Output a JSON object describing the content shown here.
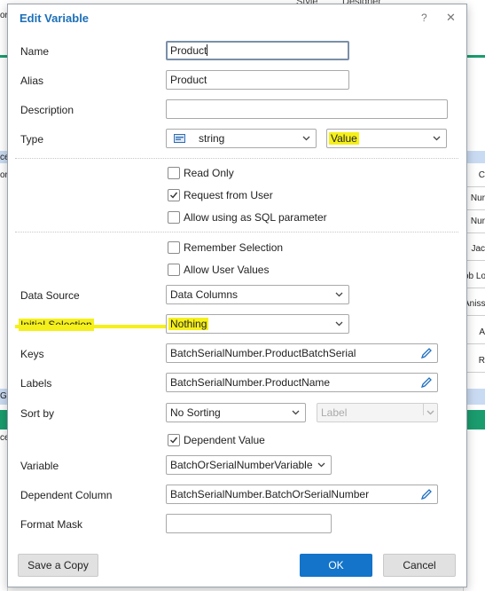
{
  "background": {
    "top_text_1": "Style",
    "top_text_2": "Designer",
    "right_cells": [
      "C",
      "Nur",
      "Nur",
      "Jac",
      "ob Lo",
      "Aniss",
      "A",
      "R"
    ],
    "left_cells": [
      "or",
      "ce",
      "or",
      "Go",
      "ce"
    ]
  },
  "dialog": {
    "title": "Edit Variable",
    "help_label": "?",
    "close_label": "✕"
  },
  "fields": {
    "name": {
      "label": "Name",
      "value": "Product"
    },
    "alias": {
      "label": "Alias",
      "value": "Product"
    },
    "description": {
      "label": "Description",
      "value": ""
    },
    "type": {
      "label": "Type",
      "value": "string",
      "kind_value": "Value"
    },
    "data_source": {
      "label": "Data Source",
      "value": "Data Columns"
    },
    "initial_selection": {
      "label": "Initial Selection",
      "value": "Nothing"
    },
    "keys": {
      "label": "Keys",
      "value": "BatchSerialNumber.ProductBatchSerial"
    },
    "labels": {
      "label": "Labels",
      "value": "BatchSerialNumber.ProductName"
    },
    "sort_by": {
      "label": "Sort by",
      "value": "No Sorting",
      "secondary_value": "Label"
    },
    "variable": {
      "label": "Variable",
      "value": "BatchOrSerialNumberVariable"
    },
    "dependent_column": {
      "label": "Dependent Column",
      "value": "BatchSerialNumber.BatchOrSerialNumber"
    },
    "format_mask": {
      "label": "Format Mask",
      "value": ""
    }
  },
  "checkboxes": {
    "read_only": {
      "label": "Read Only",
      "checked": false
    },
    "request_from_user": {
      "label": "Request from User",
      "checked": true
    },
    "allow_sql": {
      "label": "Allow using as SQL parameter",
      "checked": false
    },
    "remember_selection": {
      "label": "Remember Selection",
      "checked": false
    },
    "allow_user_values": {
      "label": "Allow User Values",
      "checked": false
    },
    "dependent_value": {
      "label": "Dependent Value",
      "checked": true
    }
  },
  "buttons": {
    "save_copy": "Save a Copy",
    "ok": "OK",
    "cancel": "Cancel"
  },
  "colors": {
    "accent": "#1374c9",
    "title": "#1c6fb8",
    "highlight": "#f5f01a",
    "background_green": "#1a9c6e"
  },
  "icons": {
    "type": "abc-type-icon",
    "edit": "pencil-icon",
    "dropdown": "chevron-down-icon",
    "check": "checkmark-icon"
  }
}
